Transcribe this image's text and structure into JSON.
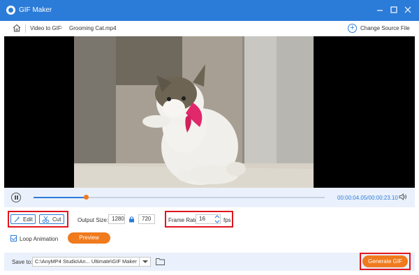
{
  "window": {
    "title": "GIF Maker",
    "minimize_icon": "minimize-icon",
    "maximize_icon": "maximize-icon",
    "close_icon": "close-icon"
  },
  "breadcrumb": {
    "home_icon": "home-icon",
    "items": [
      "Video to GIF",
      "Grooming Cat.mp4"
    ],
    "change_source_label": "Change Source File"
  },
  "player": {
    "content": "cat-video-frame",
    "progress": 0.18,
    "current_time": "00:00:04.05",
    "total_time": "00:00:23.10",
    "play_icon": "pause-icon",
    "volume_icon": "volume-icon"
  },
  "toolbar": {
    "edit_label": "Edit",
    "cut_label": "Cut",
    "output_size_label": "Output Size:",
    "width": "1280",
    "height": "720",
    "frame_rate_label": "Frame Rate:",
    "frame_rate": "16",
    "fps_label": "fps"
  },
  "options": {
    "loop_label": "Loop Animation",
    "loop_checked": true,
    "preview_label": "Preview"
  },
  "footer": {
    "save_to_label": "Save to:",
    "save_path": "C:\\AnyMP4 Studio\\An... Ultimate\\GIF Maker",
    "generate_label": "Generate GIF"
  },
  "colors": {
    "accent": "#2b7bd8",
    "orange": "#f07a1e",
    "highlight": "#e0161e",
    "panel": "#eaf1fc"
  }
}
